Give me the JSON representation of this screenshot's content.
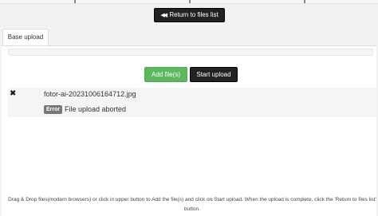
{
  "header": {
    "return_button": {
      "icon": "double-chevron-left-icon",
      "arrow_glyph": "◀◀",
      "label": "Return to files list"
    }
  },
  "tabs": [
    {
      "label": "Base upload",
      "active": true
    }
  ],
  "upload": {
    "progress": 0,
    "add_button": "Add file(s)",
    "start_button": "Start upload"
  },
  "files": [
    {
      "remove_icon": "close-icon",
      "remove_glyph": "✖",
      "name": "fotor-ai-20231006164712.jpg",
      "badge": "Error",
      "message": "File upload aborted"
    }
  ],
  "help_text": "Drag & Drop files(modern browsers) or click in upper button to Add the file(s) and click on Start upload. When the upload is complete, click the 'Return to files list' button.",
  "colors": {
    "success": "#5cb85c",
    "dark": "#222222",
    "badge": "#777777",
    "row_bg": "#f5f5f5",
    "page_bg": "#f2f2f2"
  }
}
